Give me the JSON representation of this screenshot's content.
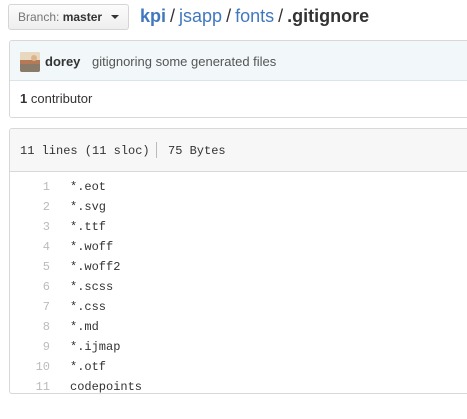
{
  "branch": {
    "prefix": "Branch:",
    "name": "master"
  },
  "breadcrumb": {
    "repo": "kpi",
    "dir1": "jsapp",
    "dir2": "fonts",
    "file": ".gitignore",
    "separator": "/"
  },
  "commit": {
    "author": "dorey",
    "message": "gitignoring some generated files"
  },
  "contributors": {
    "count": "1",
    "label": "contributor"
  },
  "file_info": {
    "lines": "11 lines (11 sloc)",
    "size": "75 Bytes"
  },
  "code_lines": [
    {
      "num": "1",
      "text": "*.eot"
    },
    {
      "num": "2",
      "text": "*.svg"
    },
    {
      "num": "3",
      "text": "*.ttf"
    },
    {
      "num": "4",
      "text": "*.woff"
    },
    {
      "num": "5",
      "text": "*.woff2"
    },
    {
      "num": "6",
      "text": "*.scss"
    },
    {
      "num": "7",
      "text": "*.css"
    },
    {
      "num": "8",
      "text": "*.md"
    },
    {
      "num": "9",
      "text": "*.ijmap"
    },
    {
      "num": "10",
      "text": "*.otf"
    },
    {
      "num": "11",
      "text": "codepoints"
    }
  ],
  "icons": {
    "branch_caret": "chevron-down-icon",
    "avatar": "user-avatar"
  }
}
